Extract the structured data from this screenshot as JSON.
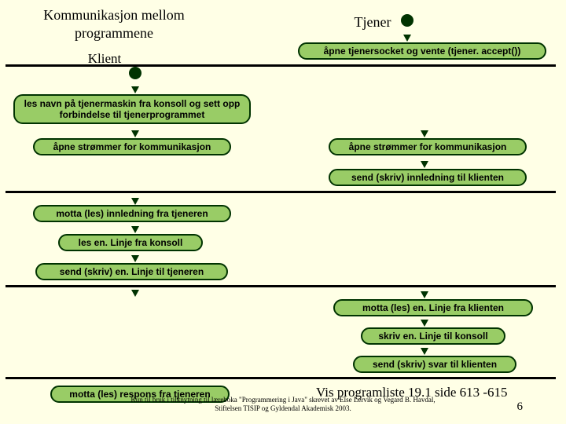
{
  "title": "Kommunikasjon mellom programmene",
  "server_label": "Tjener",
  "client_label": "Klient",
  "steps": {
    "server_open": "åpne tjenersocket og vente (tjener. accept())",
    "client_read_name": "les navn på tjenermaskin fra konsoll og sett opp forbindelse til tjenerprogrammet",
    "client_open_streams": "åpne strømmer for kommunikasjon",
    "server_open_streams": "åpne strømmer for kommunikasjon",
    "server_send_intro": "send (skriv) innledning til klienten",
    "client_recv_intro": "motta (les) innledning fra tjeneren",
    "client_read_line": "les en. Linje fra konsoll",
    "client_send_line": "send (skriv) en. Linje til tjeneren",
    "server_recv_line": "motta (les)  en. Linje fra klienten",
    "server_write_console": "skriv en. Linje til konsoll",
    "server_send_resp": "send (skriv) svar til klienten",
    "client_recv_resp": "motta (les) respons fra tjeneren"
  },
  "reference": "Vis programliste 19.1 side 613 -615",
  "footer": "Kun til bruk i tilknytning til læreboka \"Programmering i Java\" skrevet av Else Lervik og Vegard B. Havdal, Stiftelsen TISIP og Gyldendal Akademisk 2003.",
  "page": "6"
}
